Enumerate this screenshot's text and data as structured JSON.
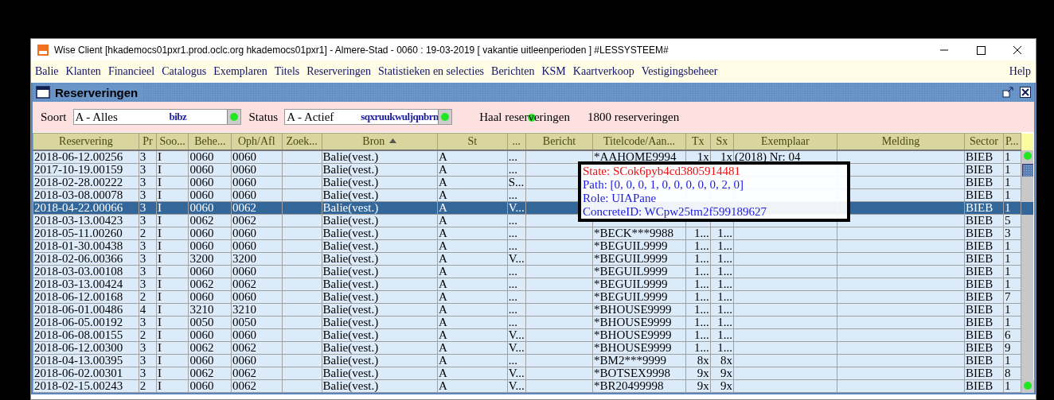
{
  "window": {
    "title": "Wise Client [hkademocs01pxr1.prod.oclc.org hkademocs01pxr1] - Almere-Stad - 0060 : 19-03-2019 [ vakantie uitleenperioden ] #LESSYSTEEM#"
  },
  "menu": [
    "Balie",
    "Klanten",
    "Financieel",
    "Catalogus",
    "Exemplaren",
    "Titels",
    "Reserveringen",
    "Statistieken en selecties",
    "Berichten",
    "KSM",
    "Kaartverkoop",
    "Vestigingsbeheer"
  ],
  "help": "Help",
  "frame": {
    "title": "Reserveringen"
  },
  "filters": [
    {
      "label": "Soort",
      "value": "A - Alles",
      "tag": "bibz"
    },
    {
      "label": "Status",
      "value": "A - Actief",
      "tag": "sqxruukwuljqnbrn"
    }
  ],
  "fetch_button": "Haal reserveringen",
  "count": "1800 reserveringen",
  "table": {
    "columns": [
      {
        "label": "Reservering"
      },
      {
        "label": "Pr"
      },
      {
        "label": "Soo..."
      },
      {
        "label": "Behe..."
      },
      {
        "label": "Oph/Afl"
      },
      {
        "label": "Zoek..."
      },
      {
        "label": "Bron",
        "sorted": true
      },
      {
        "label": "St"
      },
      {
        "label": "..."
      },
      {
        "label": "Bericht"
      },
      {
        "label": "Titelcode/Aan..."
      },
      {
        "label": "Tx"
      },
      {
        "label": "Sx"
      },
      {
        "label": "Exemplaar"
      },
      {
        "label": "Melding"
      },
      {
        "label": "Sector"
      },
      {
        "label": "P..."
      }
    ],
    "rows": [
      {
        "selected": false,
        "dot": true,
        "reservering": "2018-06-12.00256",
        "pr": "3",
        "soort": "I",
        "beheer": "0060",
        "oph_afl": "0060",
        "bron": "Balie(vest.)",
        "st": "A",
        "column_9": "...",
        "titelcode": "*AAHOME9994",
        "tx": "1x",
        "sx": "1x",
        "exemplaar": "(2018) Nr: 04",
        "sector": "BIEB",
        "column_17": "1"
      },
      {
        "selected": false,
        "dot": false,
        "reservering": "2017-10-19.00159",
        "pr": "3",
        "soort": "I",
        "beheer": "0060",
        "oph_afl": "0060",
        "bron": "Balie(vest.)",
        "st": "A",
        "column_9": "...",
        "sector": "BIEB",
        "column_17": "1"
      },
      {
        "selected": false,
        "dot": false,
        "reservering": "2018-02-28.00222",
        "pr": "3",
        "soort": "I",
        "beheer": "0060",
        "oph_afl": "0060",
        "bron": "Balie(vest.)",
        "st": "A",
        "column_9": "S...",
        "sector": "BIEB",
        "column_17": "1"
      },
      {
        "selected": false,
        "dot": false,
        "reservering": "2018-03-08.00078",
        "pr": "3",
        "soort": "I",
        "beheer": "0060",
        "oph_afl": "0060",
        "bron": "Balie(vest.)",
        "st": "A",
        "column_9": "...",
        "sector": "BIEB",
        "column_17": "1"
      },
      {
        "selected": true,
        "dot": false,
        "reservering": "2018-04-22.00066",
        "pr": "3",
        "soort": "I",
        "beheer": "0060",
        "oph_afl": "0062",
        "bron": "Balie(vest.)",
        "st": "A",
        "column_9": "V...",
        "sector": "BIEB",
        "column_17": "1"
      },
      {
        "selected": false,
        "dot": false,
        "reservering": "2018-03-13.00423",
        "pr": "3",
        "soort": "I",
        "beheer": "0062",
        "oph_afl": "0062",
        "bron": "Balie(vest.)",
        "st": "A",
        "column_9": "...",
        "sector": "BIEB",
        "column_17": "5"
      },
      {
        "selected": false,
        "dot": false,
        "reservering": "2018-05-11.00260",
        "pr": "2",
        "soort": "I",
        "beheer": "0060",
        "oph_afl": "0060",
        "bron": "Balie(vest.)",
        "st": "A",
        "column_9": "...",
        "titelcode": "*BECK***9988",
        "tx": "1...",
        "sx": "1...",
        "sector": "BIEB",
        "column_17": "3"
      },
      {
        "selected": false,
        "dot": false,
        "reservering": "2018-01-30.00438",
        "pr": "3",
        "soort": "I",
        "beheer": "0060",
        "oph_afl": "0060",
        "bron": "Balie(vest.)",
        "st": "A",
        "column_9": "...",
        "titelcode": "*BEGUIL9999",
        "tx": "1...",
        "sx": "1...",
        "sector": "BIEB",
        "column_17": "1"
      },
      {
        "selected": false,
        "dot": false,
        "reservering": "2018-02-06.00366",
        "pr": "3",
        "soort": "I",
        "beheer": "3200",
        "oph_afl": "3200",
        "bron": "Balie(vest.)",
        "st": "A",
        "column_9": "V...",
        "titelcode": "*BEGUIL9999",
        "tx": "1...",
        "sx": "1...",
        "sector": "BIEB",
        "column_17": "1"
      },
      {
        "selected": false,
        "dot": false,
        "reservering": "2018-03-03.00108",
        "pr": "3",
        "soort": "I",
        "beheer": "0060",
        "oph_afl": "0060",
        "bron": "Balie(vest.)",
        "st": "A",
        "column_9": "...",
        "titelcode": "*BEGUIL9999",
        "tx": "1...",
        "sx": "1...",
        "sector": "BIEB",
        "column_17": "1"
      },
      {
        "selected": false,
        "dot": false,
        "reservering": "2018-03-13.00424",
        "pr": "3",
        "soort": "I",
        "beheer": "0062",
        "oph_afl": "0062",
        "bron": "Balie(vest.)",
        "st": "A",
        "column_9": "...",
        "titelcode": "*BEGUIL9999",
        "tx": "1...",
        "sx": "1...",
        "sector": "BIEB",
        "column_17": "1"
      },
      {
        "selected": false,
        "dot": false,
        "reservering": "2018-06-12.00168",
        "pr": "2",
        "soort": "I",
        "beheer": "0060",
        "oph_afl": "0060",
        "bron": "Balie(vest.)",
        "st": "A",
        "column_9": "...",
        "titelcode": "*BEGUIL9999",
        "tx": "1...",
        "sx": "1...",
        "sector": "BIEB",
        "column_17": "7"
      },
      {
        "selected": false,
        "dot": false,
        "reservering": "2018-06-01.00486",
        "pr": "4",
        "soort": "I",
        "beheer": "3210",
        "oph_afl": "3210",
        "bron": "Balie(vest.)",
        "st": "A",
        "column_9": "...",
        "titelcode": "*BHOUSE9999",
        "tx": "1...",
        "sx": "1...",
        "sector": "BIEB",
        "column_17": "1"
      },
      {
        "selected": false,
        "dot": false,
        "reservering": "2018-06-05.00192",
        "pr": "3",
        "soort": "I",
        "beheer": "0050",
        "oph_afl": "0050",
        "bron": "Balie(vest.)",
        "st": "A",
        "column_9": "...",
        "titelcode": "*BHOUSE9999",
        "tx": "1...",
        "sx": "1...",
        "sector": "BIEB",
        "column_17": "1"
      },
      {
        "selected": false,
        "dot": false,
        "reservering": "2018-06-08.00155",
        "pr": "2",
        "soort": "I",
        "beheer": "0060",
        "oph_afl": "0060",
        "bron": "Balie(vest.)",
        "st": "A",
        "column_9": "V...",
        "titelcode": "*BHOUSE9999",
        "tx": "1...",
        "sx": "1...",
        "sector": "BIEB",
        "column_17": "6"
      },
      {
        "selected": false,
        "dot": false,
        "reservering": "2018-06-12.00300",
        "pr": "3",
        "soort": "I",
        "beheer": "0062",
        "oph_afl": "0062",
        "bron": "Balie(vest.)",
        "st": "A",
        "column_9": "V...",
        "titelcode": "*BHOUSE9999",
        "tx": "1...",
        "sx": "1...",
        "sector": "BIEB",
        "column_17": "9"
      },
      {
        "selected": false,
        "dot": false,
        "reservering": "2018-04-13.00395",
        "pr": "3",
        "soort": "I",
        "beheer": "0060",
        "oph_afl": "0060",
        "bron": "Balie(vest.)",
        "st": "A",
        "column_9": "...",
        "titelcode": "*BM2***9999",
        "tx": "8x",
        "sx": "8x",
        "sector": "BIEB",
        "column_17": "1"
      },
      {
        "selected": false,
        "dot": false,
        "reservering": "2018-06-02.00301",
        "pr": "3",
        "soort": "I",
        "beheer": "0062",
        "oph_afl": "0062",
        "bron": "Balie(vest.)",
        "st": "A",
        "column_9": "V...",
        "titelcode": "*BOTSEX9998",
        "tx": "9x",
        "sx": "9x",
        "sector": "BIEB",
        "column_17": "8"
      },
      {
        "selected": false,
        "dot": true,
        "reservering": "2018-02-15.00243",
        "pr": "2",
        "soort": "I",
        "beheer": "0060",
        "oph_afl": "0062",
        "bron": "Balie(vest.)",
        "st": "A",
        "column_9": "V...",
        "titelcode": "*BR20499998",
        "tx": "9x",
        "sx": "9x",
        "sector": "BIEB",
        "column_17": "1"
      }
    ]
  },
  "inspector": [
    {
      "kind": "state",
      "text": "State: SCok6pyb4cd3805914481"
    },
    {
      "kind": "info",
      "text": "Path: [0, 0, 0, 1, 0, 0, 0, 0, 0, 2, 0]"
    },
    {
      "kind": "info",
      "text": "Role: UIAPane"
    },
    {
      "kind": "info",
      "text": "ConcreteID: WCpw25tm2f599189627"
    }
  ]
}
